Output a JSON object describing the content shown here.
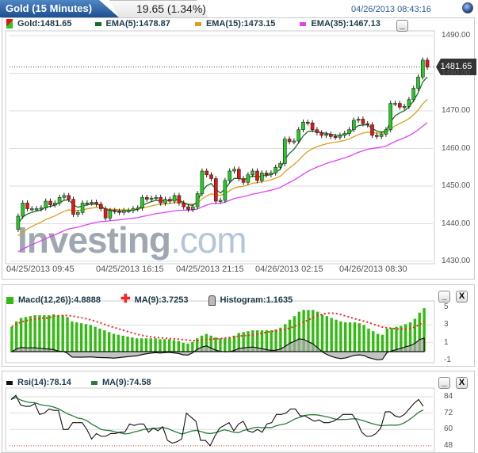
{
  "header": {
    "title": "Gold (15 Minutes)",
    "change": "19.65 (1.34%)",
    "datetime": "04/26/2013 08:43:16"
  },
  "main": {
    "legend": {
      "gold": "Gold:1481.65",
      "ema5": "EMA(5):1478.87",
      "ema15": "EMA(15):1473.15",
      "ema35": "EMA(35):1467.13"
    },
    "last_price_tag": "1481.65",
    "y_ticks": [
      "1490.00",
      "1480.00",
      "1470.00",
      "1460.00",
      "1450.00",
      "1440.00",
      "1430.00"
    ],
    "x_ticks": [
      "04/25/2013 09:45",
      "04/25/2013 16:15",
      "04/25/2013 21:15",
      "04/26/2013 02:15",
      "04/26/2013 08:30"
    ],
    "watermark": "Investing.com",
    "minimize_label": "_"
  },
  "macd": {
    "legend": {
      "macd": "Macd(12,26)):4.8888",
      "ma": "MA(9):3.7253",
      "hist": "Histogram:1.1635"
    },
    "y_ticks": [
      "5",
      "3",
      "1",
      "-1"
    ],
    "minimize_label": "_",
    "close_label": "X"
  },
  "rsi": {
    "legend": {
      "rsi": "Rsi(14):78.14",
      "ma": "MA(9):74.58"
    },
    "y_ticks": [
      "84",
      "72",
      "60",
      "48"
    ],
    "minimize_label": "_",
    "close_label": "X"
  },
  "colors": {
    "up": "#22cc22",
    "down": "#ee1111",
    "ema5": "#1a6b2a",
    "ema15": "#d9a020",
    "ema35": "#dd44ee",
    "macd": "#33bb11",
    "macd_ma": "#ff2222",
    "hist": "#aaaaaa",
    "rsi": "#111111",
    "rsi_ma": "#2a7a3a",
    "accent": "#1d4f8f"
  },
  "chart_data": [
    {
      "type": "candlestick",
      "title": "Gold (15 Minutes)",
      "ylim": [
        1430,
        1490
      ],
      "first_open": 1438.5,
      "close": [
        1442,
        1445.5,
        1444,
        1444,
        1444,
        1444.2,
        1446,
        1445,
        1445.5,
        1447,
        1447.5,
        1446.5,
        1442.5,
        1443,
        1445.5,
        1445.5,
        1445.7,
        1445.2,
        1444,
        1441.5,
        1443.5,
        1443.3,
        1443,
        1443.5,
        1443.5,
        1444,
        1444.2,
        1447,
        1446.5,
        1446.8,
        1447,
        1445.5,
        1446.5,
        1446,
        1447.5,
        1445.5,
        1444.5,
        1443.8,
        1444.5,
        1448,
        1454,
        1453,
        1452,
        1446,
        1446.2,
        1451.5,
        1454,
        1454.5,
        1452,
        1451,
        1453,
        1454,
        1451.5,
        1453.5,
        1453,
        1453.5,
        1455,
        1456,
        1462.5,
        1461.8,
        1462,
        1465,
        1467,
        1466.8,
        1465,
        1464.2,
        1463.5,
        1463.8,
        1463.2,
        1463,
        1463.5,
        1464,
        1465,
        1467.5,
        1467.8,
        1466.6,
        1466.3,
        1463.5,
        1463.2,
        1463.8,
        1465,
        1472,
        1472,
        1471,
        1471.2,
        1473,
        1476,
        1479,
        1483.5,
        1481.65
      ]
    },
    {
      "type": "bar",
      "ylim": [
        -1,
        5
      ],
      "macd": [
        2.8,
        3.4,
        3.8,
        3.9,
        4,
        4.1,
        4.1,
        4.1,
        4.1,
        4.2,
        4.1,
        4.1,
        3.9,
        3.4,
        3.3,
        3.2,
        3.1,
        3.0,
        2.8,
        2.6,
        2.4,
        2.2,
        2.0,
        1.9,
        1.8,
        1.7,
        1.6,
        1.5,
        1.5,
        1.5,
        1.5,
        1.5,
        1.4,
        1.4,
        1.4,
        1.3,
        1.2,
        1.0,
        0.9,
        1.1,
        1.5,
        1.8,
        2.0,
        1.8,
        1.6,
        1.5,
        1.5,
        1.6,
        1.8,
        2.1,
        2.2,
        2.3,
        2.4,
        2.4,
        2.4,
        2.4,
        2.4,
        2.5,
        2.7,
        3.1,
        3.6,
        4.0,
        4.5,
        4.7,
        4.7,
        4.7,
        4.5,
        4.2,
        4.0,
        3.8,
        3.6,
        3.4,
        3.3,
        3.3,
        3.3,
        3.2,
        3.0,
        2.6,
        2.3,
        2.0,
        1.9,
        2.6,
        2.7,
        2.8,
        2.9,
        3.1,
        3.3,
        3.7,
        4.4,
        4.9
      ]
    },
    {
      "type": "line",
      "ylim": [
        48,
        84
      ],
      "rsi": [
        82,
        85,
        78,
        77,
        77,
        79,
        71,
        72,
        75,
        74,
        74,
        60,
        60,
        65,
        65,
        65,
        60,
        53,
        57,
        55,
        55,
        57,
        57,
        58,
        58,
        64,
        63,
        64,
        64,
        58,
        61,
        59,
        62,
        52,
        50,
        51,
        53,
        72,
        69,
        66,
        52,
        52,
        48,
        55,
        61,
        63,
        65,
        59,
        64,
        66,
        59,
        58,
        60,
        58,
        64,
        65,
        71,
        71,
        72,
        75,
        75,
        70,
        70,
        68,
        66,
        67,
        65,
        65,
        66,
        68,
        71,
        71,
        71,
        66,
        58,
        55,
        55,
        57,
        61,
        73,
        73,
        70,
        69,
        71,
        75,
        79,
        82,
        77
      ]
    }
  ]
}
